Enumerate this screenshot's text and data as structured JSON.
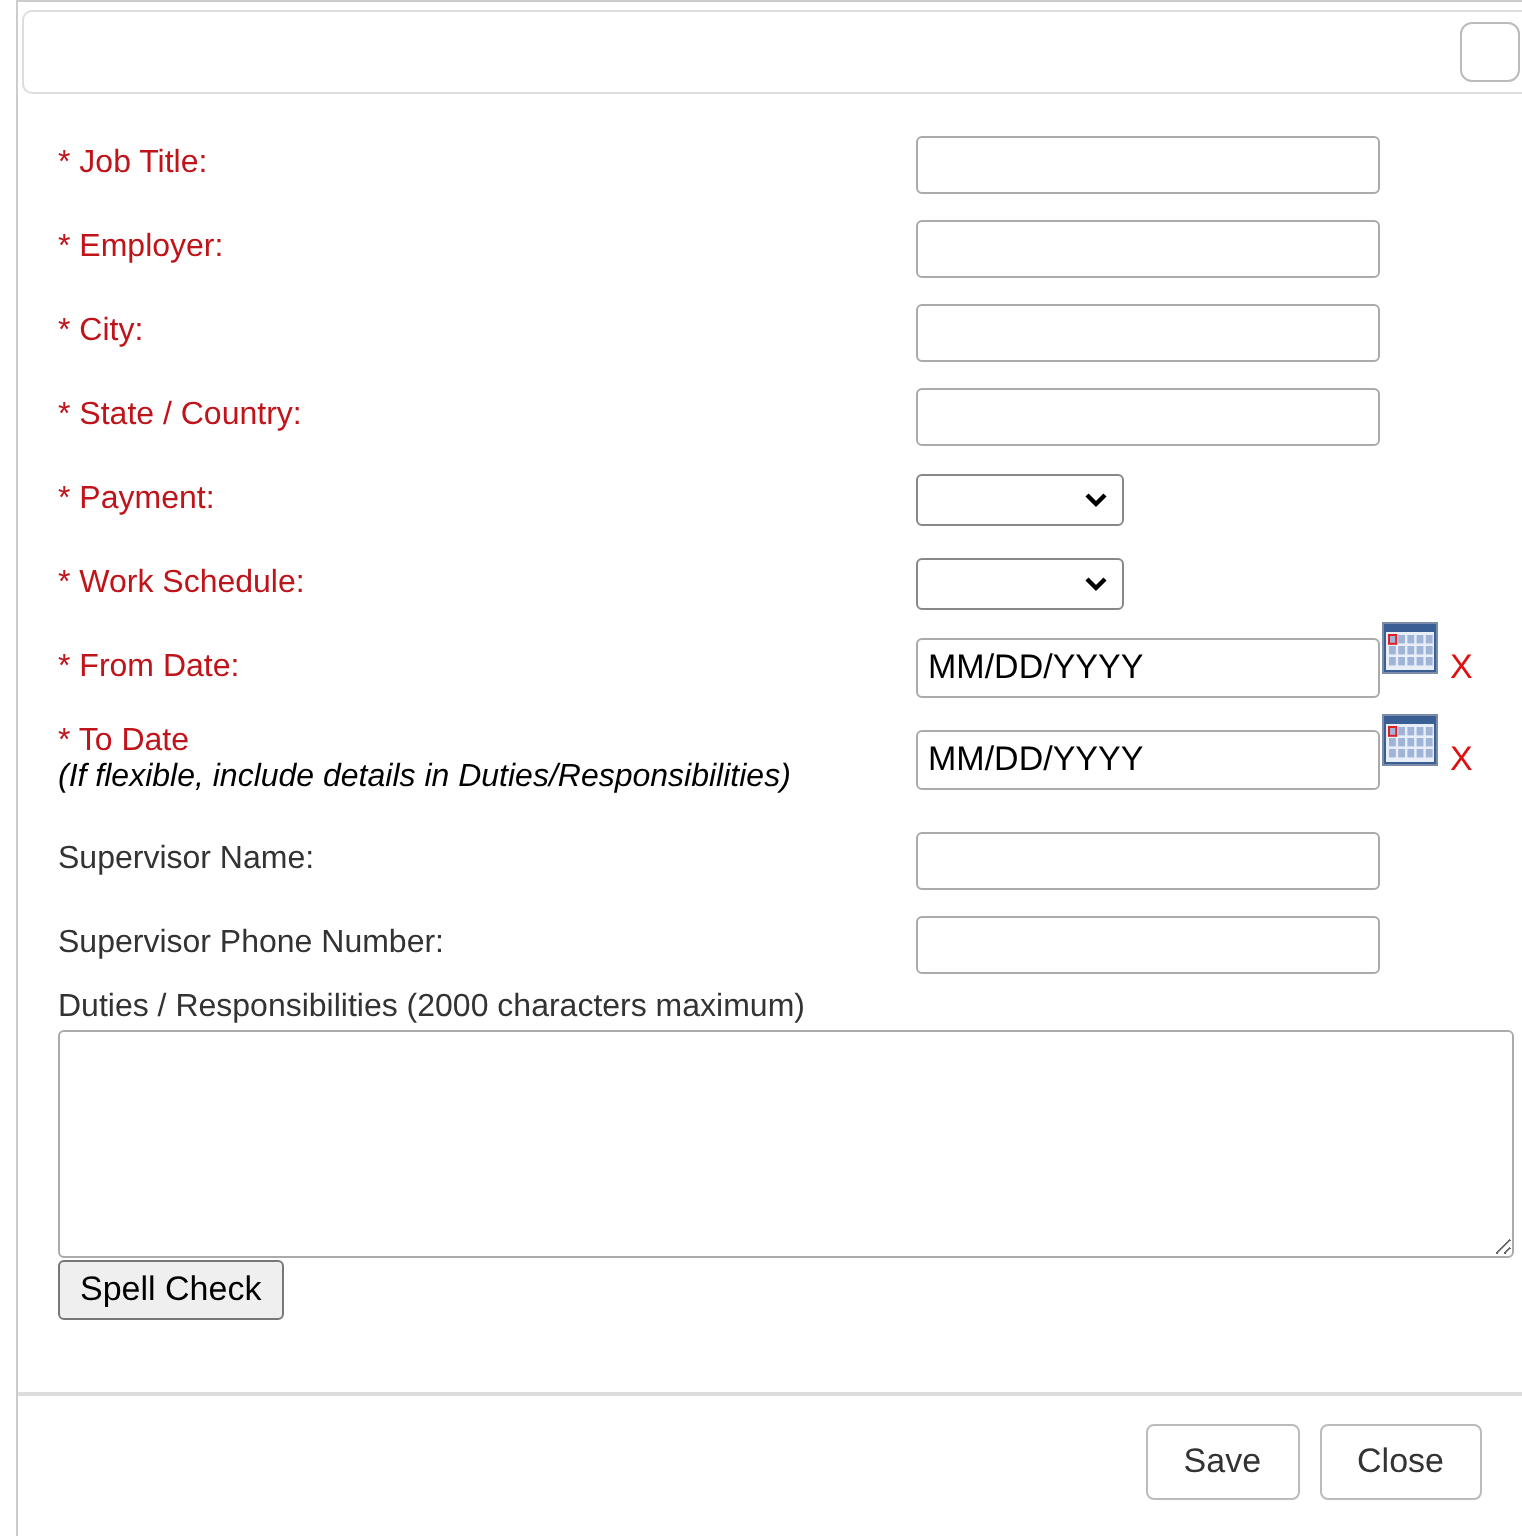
{
  "fields": [
    {
      "label": "* Job Title:",
      "required": true,
      "kind": "text"
    },
    {
      "label": "* Employer:",
      "required": true,
      "kind": "text"
    },
    {
      "label": "* City:",
      "required": true,
      "kind": "text"
    },
    {
      "label": "* State / Country:",
      "required": true,
      "kind": "text"
    },
    {
      "label": "* Payment:",
      "required": true,
      "kind": "select"
    },
    {
      "label": "* Work Schedule:",
      "required": true,
      "kind": "select"
    },
    {
      "label": "* From Date:",
      "required": true,
      "kind": "date",
      "value": "MM/DD/YYYY",
      "clear": "X"
    },
    {
      "label": "* To Date",
      "note": "(If flexible, include details in Duties/Responsibilities)",
      "required": true,
      "kind": "date",
      "value": "MM/DD/YYYY",
      "clear": "X"
    },
    {
      "label": "Supervisor Name:",
      "required": false,
      "kind": "text"
    },
    {
      "label": "Supervisor Phone Number:",
      "required": false,
      "kind": "text"
    }
  ],
  "duties": {
    "label": "Duties / Responsibilities (2000 characters maximum)"
  },
  "spell_check": "Spell Check",
  "buttons": [
    "Save",
    "Close"
  ]
}
